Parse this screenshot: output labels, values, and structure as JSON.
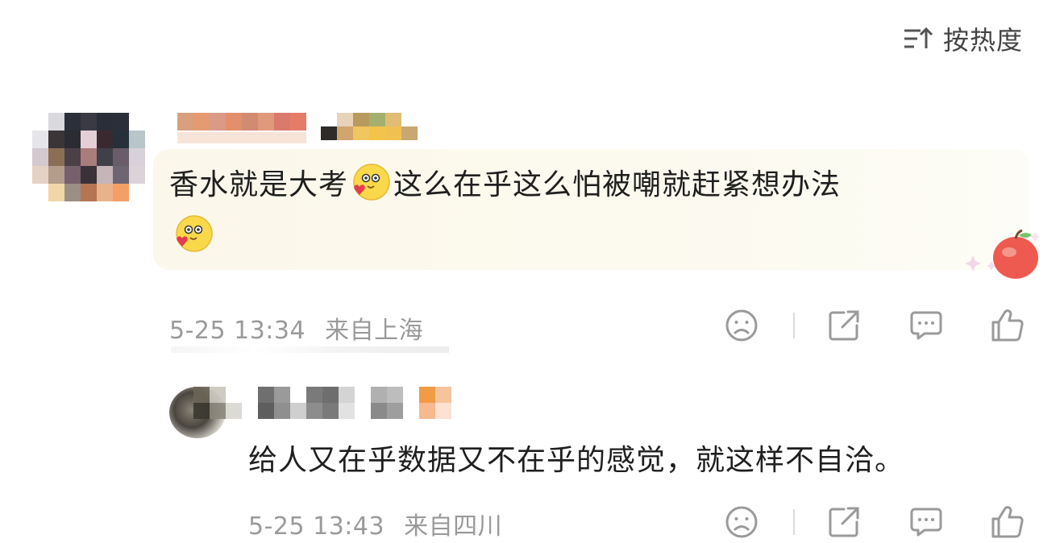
{
  "sort": {
    "label": "按热度",
    "icon": "sort-icon"
  },
  "comment": {
    "avatar_icon": "pixelated-avatar",
    "username_icon": "pixelated-username",
    "text_part1": "香水就是大考",
    "text_part2": "这么在乎这么怕被嘲就赶紧想办法",
    "emoji": "heart-smile-emoji",
    "sticker": "apple-sticker",
    "date": "5-25 13:34",
    "location": "来自上海",
    "actions": [
      "dislike-icon",
      "share-icon",
      "comment-icon",
      "like-icon"
    ]
  },
  "reply": {
    "avatar_icon": "pixelated-avatar",
    "username_icon": "pixelated-username",
    "text": "给人又在乎数据又不在乎的感觉，就这样不自洽。",
    "date": "5-25 13:43",
    "location": "来自四川",
    "actions": [
      "dislike-icon",
      "share-icon",
      "comment-icon",
      "like-icon"
    ]
  },
  "colors": {
    "bubble": "#fbf7ea",
    "meta": "#9a9a9a",
    "icon": "#9a9a9a",
    "text": "#1f1f1f"
  }
}
